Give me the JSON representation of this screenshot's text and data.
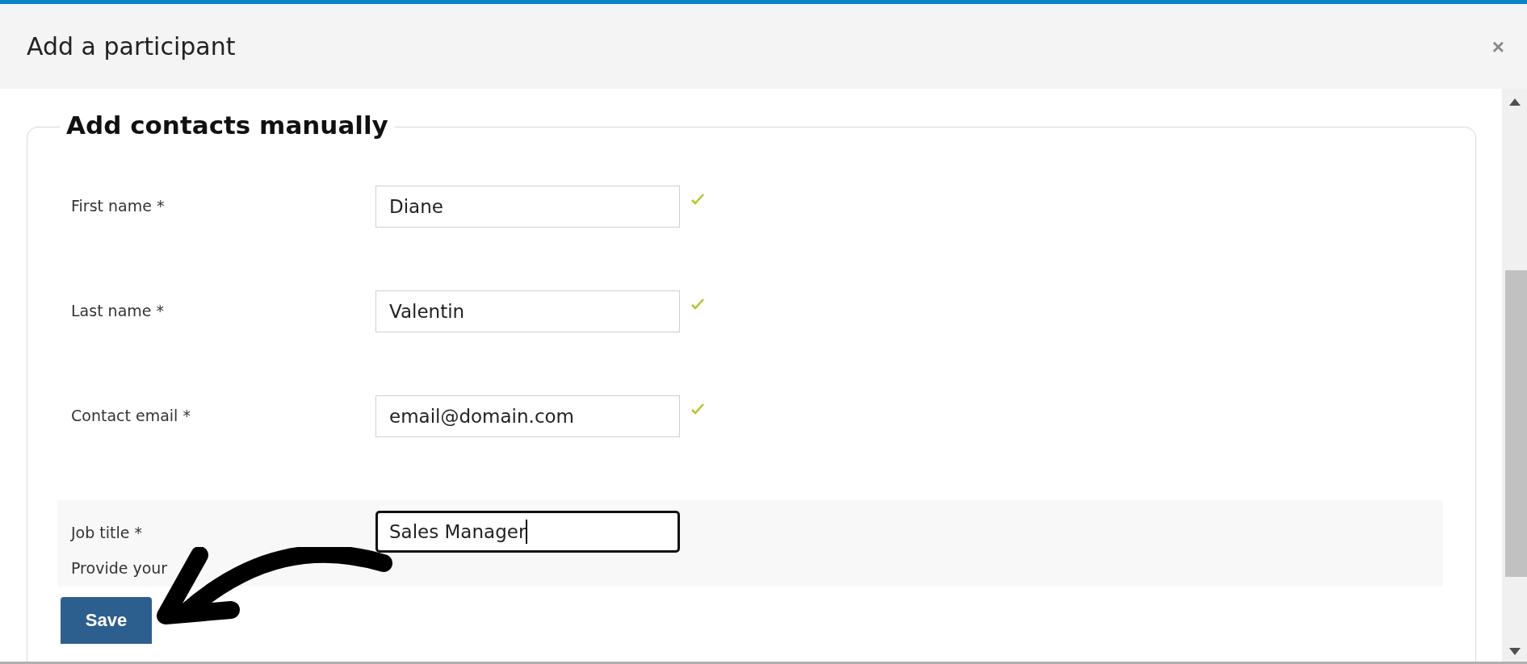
{
  "dialog": {
    "title": "Add a participant",
    "close": "×"
  },
  "section": {
    "legend": "Add contacts manually"
  },
  "fields": [
    {
      "label": "First name *",
      "value": "Diane",
      "valid": true,
      "focused": false
    },
    {
      "label": "Last name *",
      "value": "Valentin",
      "valid": true,
      "focused": false
    },
    {
      "label": "Contact email *",
      "value": "email@domain.com",
      "valid": true,
      "focused": false
    },
    {
      "label": "Job title *",
      "value": "Sales Manager",
      "hint": "Provide your",
      "valid": false,
      "focused": true
    }
  ],
  "buttons": [
    {
      "label": "Save"
    }
  ]
}
